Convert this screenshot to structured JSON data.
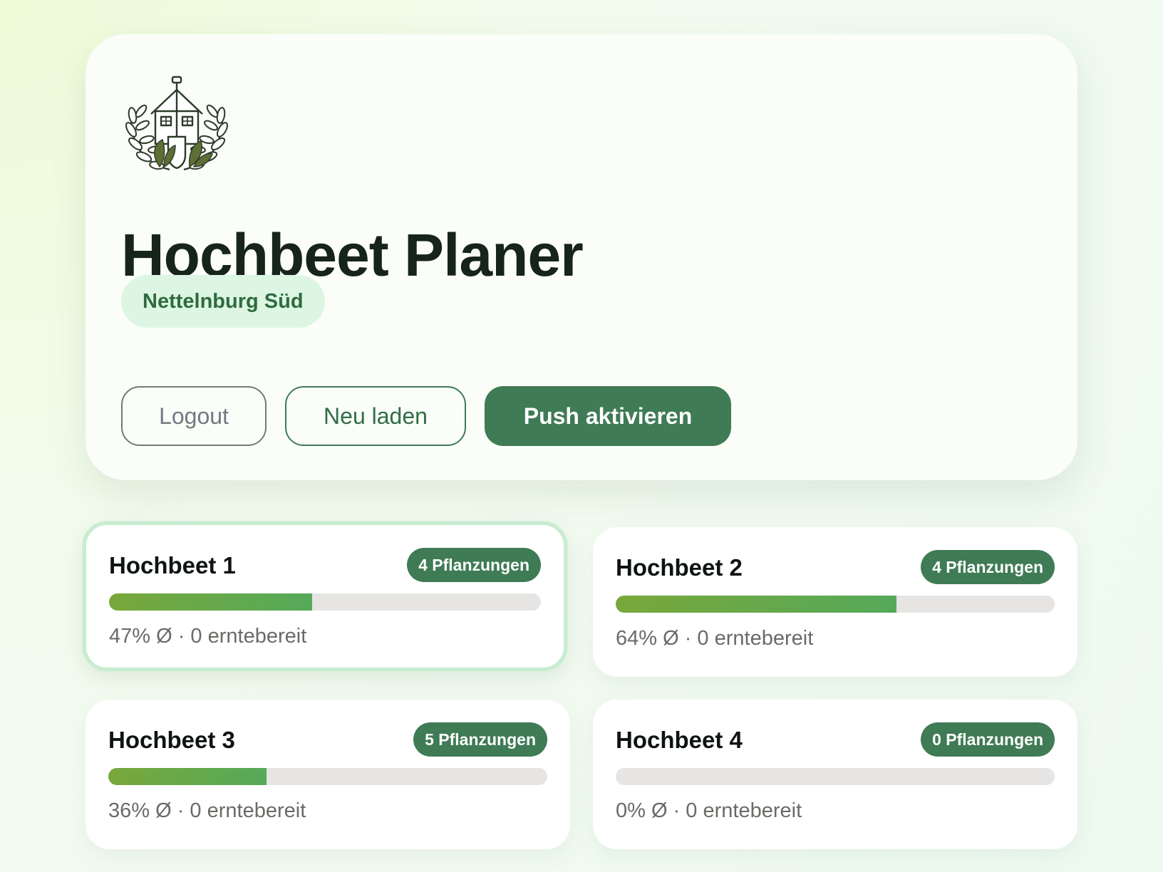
{
  "app": {
    "title": "Hochbeet Planer",
    "location": "Nettelnburg Süd",
    "logo_icon": "garden-house-wreath-logo"
  },
  "actions": {
    "logout": "Logout",
    "reload": "Neu laden",
    "push": "Push aktivieren"
  },
  "colors": {
    "primary": "#3f7b55",
    "badge_bg": "#dcf6e3",
    "progress_start": "#79a83a",
    "progress_end": "#55a95a",
    "track": "#e6e5e4"
  },
  "beds": [
    {
      "name": "Hochbeet 1",
      "badge": "4 Pflanzungen",
      "progress": 0.47,
      "stats": "47% Ø · 0 erntebereit",
      "selected": true
    },
    {
      "name": "Hochbeet 2",
      "badge": "4 Pflanzungen",
      "progress": 0.64,
      "stats": "64% Ø · 0 erntebereit",
      "selected": false
    },
    {
      "name": "Hochbeet 3",
      "badge": "5 Pflanzungen",
      "progress": 0.36,
      "stats": "36% Ø · 0 erntebereit",
      "selected": false
    },
    {
      "name": "Hochbeet 4",
      "badge": "0 Pflanzungen",
      "progress": 0.0,
      "stats": "0% Ø · 0 erntebereit",
      "selected": false
    }
  ]
}
